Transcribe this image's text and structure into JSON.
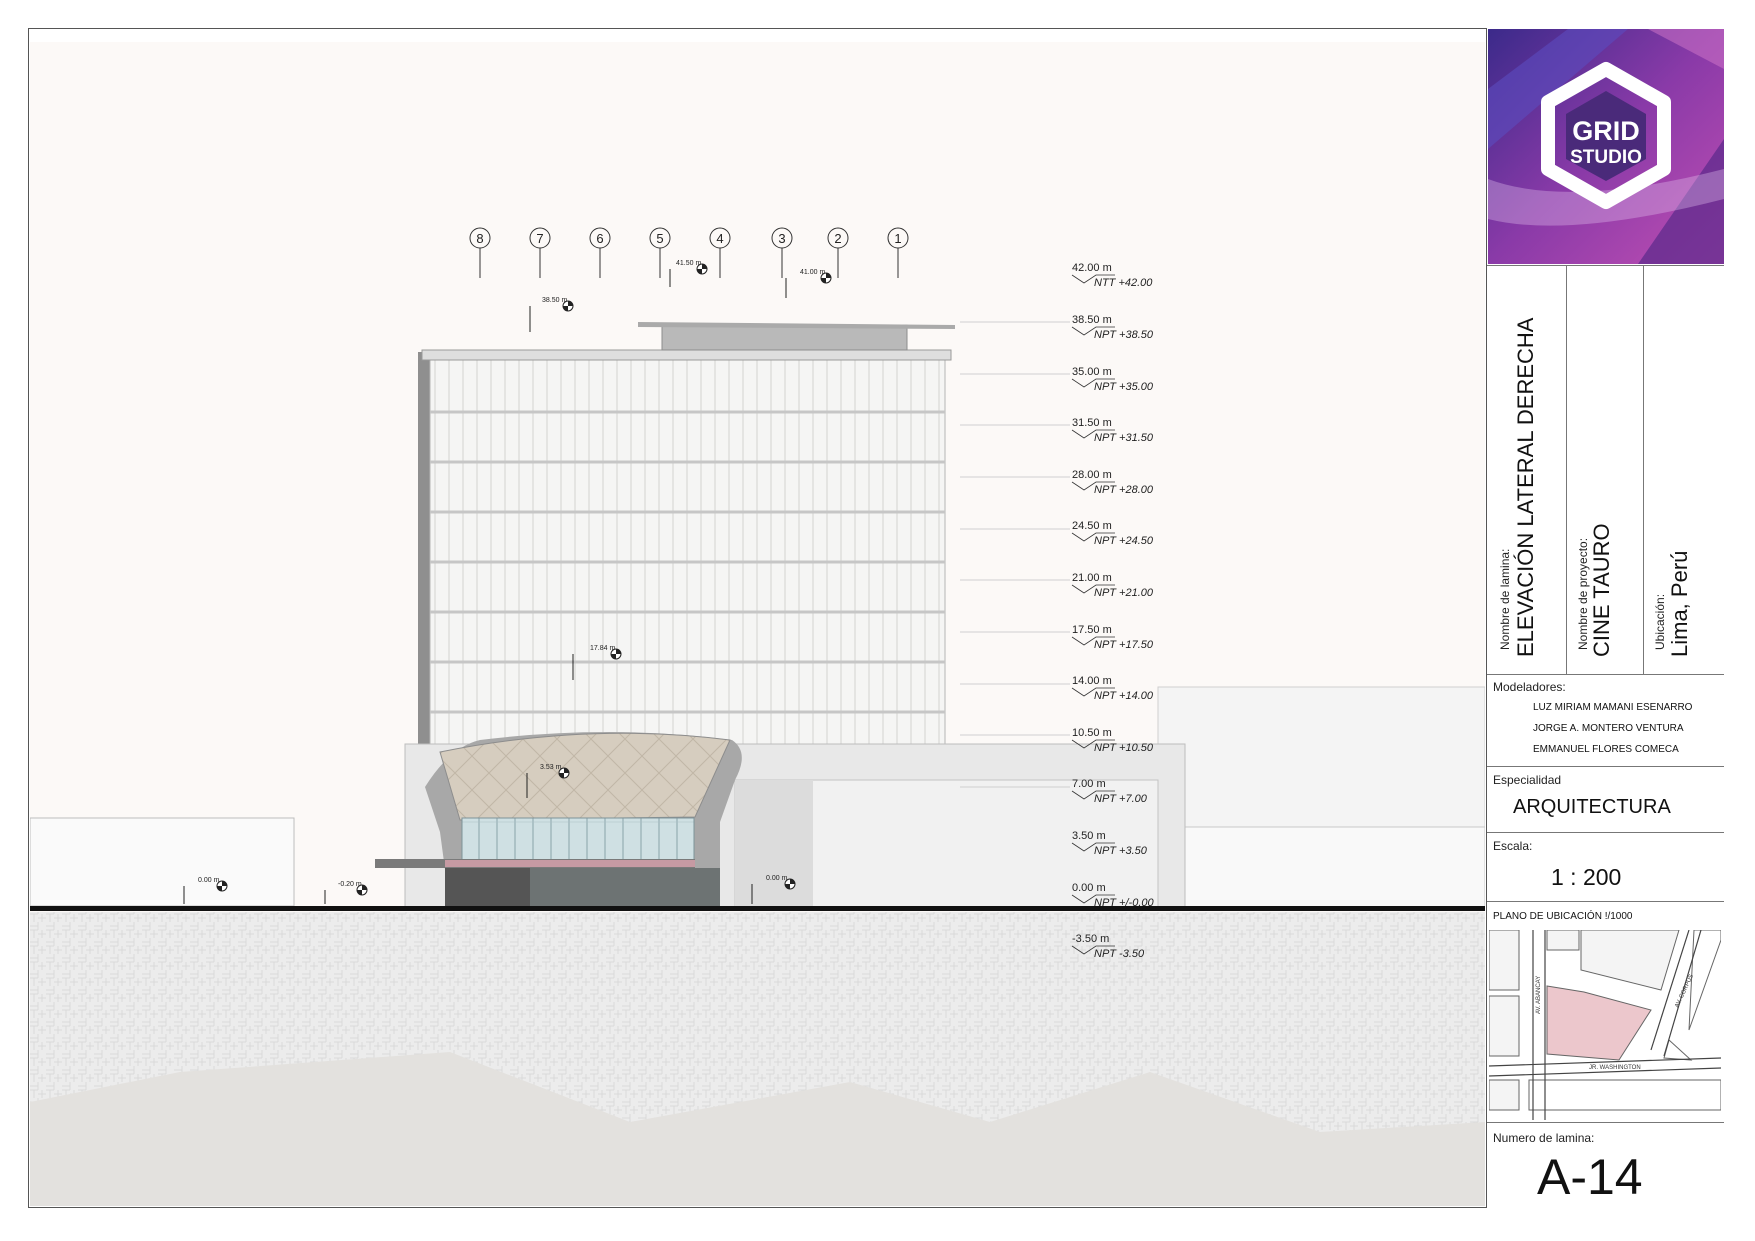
{
  "title_block": {
    "logo": {
      "line1": "GRID",
      "line2": "STUDIO"
    },
    "sheet_name_label": "Nombre de lamina:",
    "sheet_name": "ELEVACIÓN LATERAL DERECHA",
    "project_label": "Nombre de proyecto:",
    "project_name": "CINE TAURO",
    "location_label": "Ubicación:",
    "location": "Lima, Perú",
    "modelers_label": "Modeladores:",
    "modelers": [
      "LUZ MIRIAM MAMANI ESENARRO",
      "JORGE A. MONTERO VENTURA",
      "EMMANUEL FLORES  COMECA"
    ],
    "specialty_label": "Especialidad",
    "specialty": "ARQUITECTURA",
    "scale_label": "Escala:",
    "scale": "1 : 200",
    "location_plan_label": "PLANO DE UBICACIÓN !/1000",
    "streets": [
      "AV. ABANCAY",
      "AV. CORPUS",
      "JR. WASHINGTON"
    ],
    "sheet_number_label": "Numero de lamina:",
    "sheet_number": "A-14"
  },
  "grid_axes": [
    "8",
    "7",
    "6",
    "5",
    "4",
    "3",
    "2",
    "1"
  ],
  "levels": [
    {
      "elev": "42.00 m",
      "tag": "NTT +42.00"
    },
    {
      "elev": "38.50 m",
      "tag": "NPT +38.50"
    },
    {
      "elev": "35.00 m",
      "tag": "NPT +35.00"
    },
    {
      "elev": "31.50 m",
      "tag": "NPT +31.50"
    },
    {
      "elev": "28.00 m",
      "tag": "NPT +28.00"
    },
    {
      "elev": "24.50 m",
      "tag": "NPT +24.50"
    },
    {
      "elev": "21.00 m",
      "tag": "NPT +21.00"
    },
    {
      "elev": "17.50 m",
      "tag": "NPT +17.50"
    },
    {
      "elev": "14.00 m",
      "tag": "NPT +14.00"
    },
    {
      "elev": "10.50 m",
      "tag": "NPT +10.50"
    },
    {
      "elev": "7.00 m",
      "tag": "NPT +7.00"
    },
    {
      "elev": "3.50 m",
      "tag": "NPT +3.50"
    },
    {
      "elev": "0.00 m",
      "tag": "NPT +/-0.00"
    },
    {
      "elev": "-3.50 m",
      "tag": "NPT -3.50"
    }
  ],
  "spot_marks": [
    "41.50 m",
    "41.00 m",
    "38.50 m",
    "17.84 m",
    "3.53 m",
    "0.00 m",
    "-0.20 m",
    "0.00 m"
  ],
  "colors": {
    "accent_purple": "#6a2a8c",
    "site_pink": "#ecc7cc",
    "canopy": "#d9d1c4",
    "glass": "#c8dde0"
  }
}
